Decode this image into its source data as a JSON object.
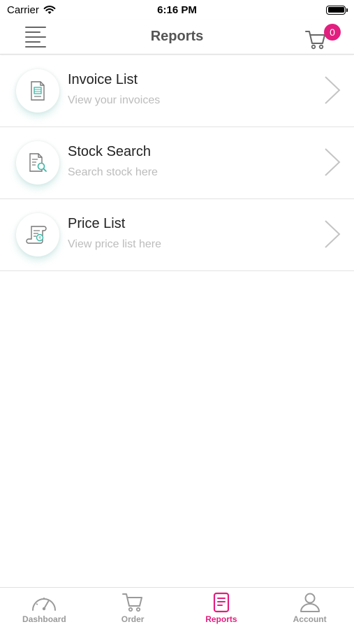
{
  "status_bar": {
    "carrier": "Carrier",
    "time": "6:16 PM"
  },
  "header": {
    "title": "Reports",
    "cart_count": "0"
  },
  "reports": [
    {
      "title": "Invoice List",
      "subtitle": "View your invoices",
      "icon": "invoice-icon"
    },
    {
      "title": "Stock Search",
      "subtitle": "Search stock here",
      "icon": "stock-search-icon"
    },
    {
      "title": "Price List",
      "subtitle": "View price list here",
      "icon": "price-list-icon"
    }
  ],
  "tabs": [
    {
      "label": "Dashboard",
      "icon": "dashboard-icon",
      "active": false
    },
    {
      "label": "Order",
      "icon": "cart-icon",
      "active": false
    },
    {
      "label": "Reports",
      "icon": "reports-icon",
      "active": true
    },
    {
      "label": "Account",
      "icon": "account-icon",
      "active": false
    }
  ],
  "colors": {
    "accent": "#e21f7f",
    "icon_teal": "#3bb7a8",
    "text_muted": "#bcbcbc"
  }
}
